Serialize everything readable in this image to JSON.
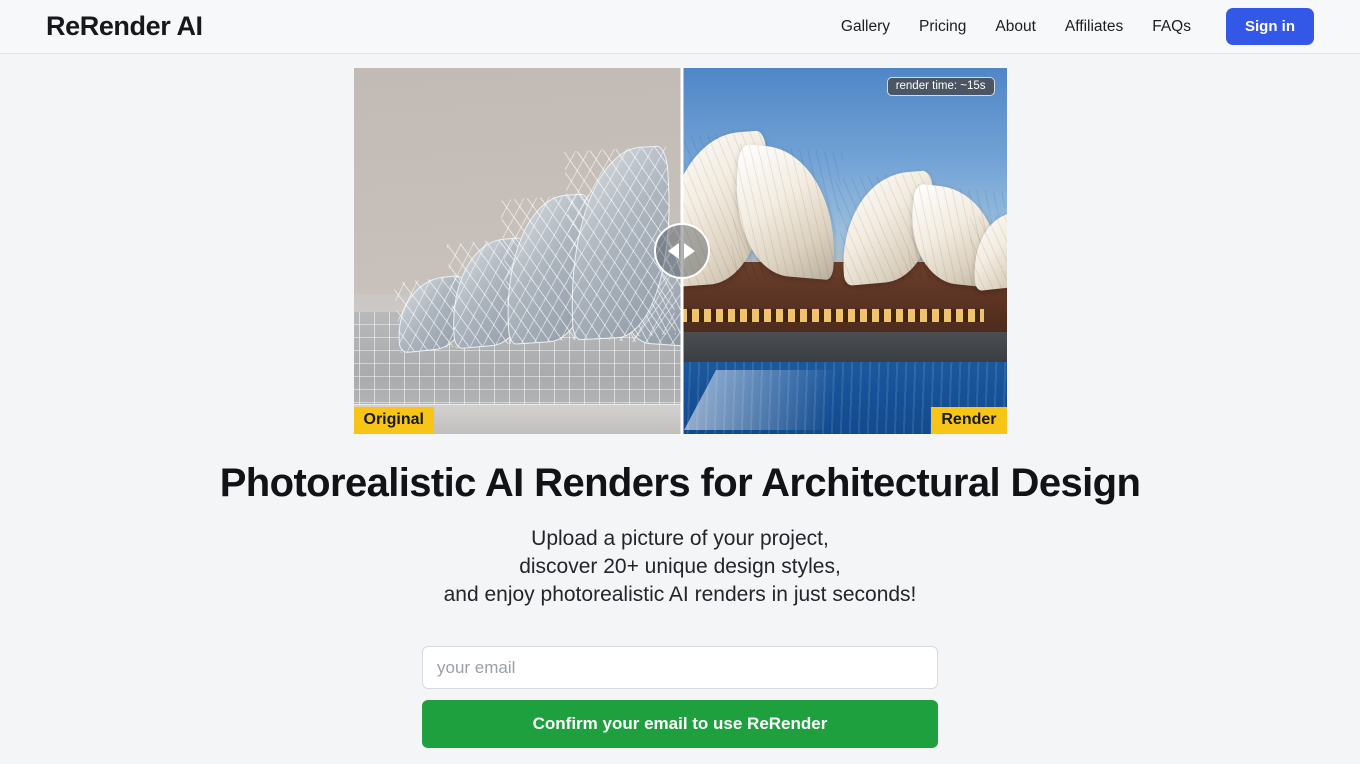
{
  "header": {
    "brand": "ReRender AI",
    "nav": [
      {
        "label": "Gallery"
      },
      {
        "label": "Pricing"
      },
      {
        "label": "About"
      },
      {
        "label": "Affiliates"
      },
      {
        "label": "FAQs"
      }
    ],
    "signin_label": "Sign in"
  },
  "hero": {
    "render_time_badge": "render time: ~15s",
    "original_tag": "Original",
    "render_tag": "Render",
    "slider_left_icon": "triangle-left-icon",
    "slider_right_icon": "triangle-right-icon"
  },
  "main": {
    "headline": "Photorealistic AI Renders for Architectural Design",
    "subcopy_line1": "Upload a picture of your project,",
    "subcopy_line2": "discover 20+ unique design styles,",
    "subcopy_line3": "and enjoy photorealistic AI renders in just seconds!"
  },
  "form": {
    "email_placeholder": "your email",
    "email_value": "",
    "cta_label": "Confirm your email to use ReRender"
  },
  "colors": {
    "accent_blue": "#3358e8",
    "cta_green": "#1fa03f",
    "tag_yellow": "#f6c518",
    "badge_slate": "#4b5563",
    "page_bg": "#f4f5f7"
  }
}
